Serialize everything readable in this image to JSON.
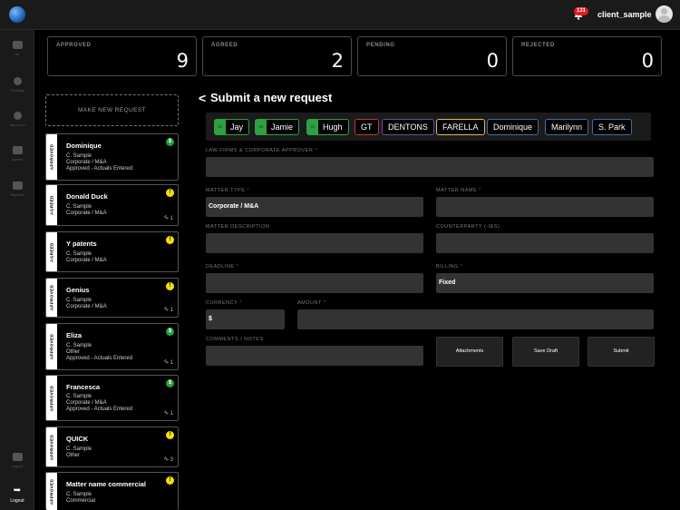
{
  "header": {
    "notification_count": "131",
    "username": "client_sample"
  },
  "sidebar": {
    "items": [
      {
        "label": "All",
        "icon": "inbox-icon"
      },
      {
        "label": "Pending",
        "icon": "gear-icon"
      },
      {
        "label": "Approved",
        "icon": "dollar-icon"
      },
      {
        "label": "Agreed",
        "icon": "calendar-icon"
      },
      {
        "label": "Rejected",
        "icon": "trophy-icon"
      },
      {
        "label": "Logout",
        "icon": "trophy-icon"
      }
    ],
    "logout_label": "Logout"
  },
  "stats": [
    {
      "label": "APPROVED",
      "value": "9"
    },
    {
      "label": "AGREED",
      "value": "2"
    },
    {
      "label": "PENDING",
      "value": "0"
    },
    {
      "label": "REJECTED",
      "value": "0"
    }
  ],
  "make_new_request_label": "MAKE NEW REQUEST",
  "requests": [
    {
      "status": "APPROVED",
      "title": "Dominique",
      "lines": [
        "C. Sample",
        "Corporate / M&A",
        "Approved - Actuals Entered"
      ],
      "indicator": "$",
      "indicator_type": "money",
      "attachments": ""
    },
    {
      "status": "AGREED",
      "title": "Donald Duck",
      "lines": [
        "C. Sample",
        "Corporate / M&A"
      ],
      "indicator": "!",
      "indicator_type": "warn",
      "attachments": "1"
    },
    {
      "status": "AGREED",
      "title": "Y patents",
      "lines": [
        "C. Sample",
        "Corporate / M&A"
      ],
      "indicator": "!",
      "indicator_type": "warn",
      "attachments": ""
    },
    {
      "status": "APPROVED",
      "title": "Genius",
      "lines": [
        "C. Sample",
        "Corporate / M&A"
      ],
      "indicator": "!",
      "indicator_type": "warn",
      "attachments": "1"
    },
    {
      "status": "APPROVED",
      "title": "Eliza",
      "lines": [
        "C. Sample",
        "Other",
        "Approved - Actuals Entered"
      ],
      "indicator": "$",
      "indicator_type": "money",
      "attachments": "1"
    },
    {
      "status": "APPROVED",
      "title": "Francesca",
      "lines": [
        "C. Sample",
        "Corporate / M&A",
        "Approved - Actuals Entered"
      ],
      "indicator": "$",
      "indicator_type": "money",
      "attachments": "1"
    },
    {
      "status": "APPROVED",
      "title": "QUICK",
      "lines": [
        "C. Sample",
        "Other"
      ],
      "indicator": "!",
      "indicator_type": "warn",
      "attachments": "3"
    },
    {
      "status": "APPROVED",
      "title": "Matter name commercial",
      "lines": [
        "C. Sample",
        "Commercial"
      ],
      "indicator": "!",
      "indicator_type": "warn",
      "attachments": ""
    }
  ],
  "form": {
    "title": "Submit a new request",
    "chips": [
      {
        "cc": "cc",
        "label": "Jay",
        "style": "cc"
      },
      {
        "cc": "cc",
        "label": "Jamie",
        "style": "cc"
      },
      {
        "cc": "cc",
        "label": "Hugh",
        "style": "cc"
      },
      {
        "cc": "",
        "label": "GT",
        "style": "red"
      },
      {
        "cc": "",
        "label": "DENTONS",
        "style": "purple"
      },
      {
        "cc": "",
        "label": "FARELLA",
        "style": "yellow"
      },
      {
        "cc": "",
        "label": "Dominique",
        "style": "blue"
      },
      {
        "cc": "",
        "label": "Marilynn",
        "style": "blue"
      },
      {
        "cc": "",
        "label": "S. Park",
        "style": "blue"
      }
    ],
    "law_firms_label": "LAW FIRMS & CORPORATE APPROVER",
    "law_firms_value": "",
    "matter_type_label": "MATTER TYPE",
    "matter_type_value": "Corporate / M&A",
    "matter_name_label": "MATTER NAME",
    "matter_name_value": "",
    "matter_description_label": "MATTER DESCRIPTION",
    "matter_description_value": "",
    "counterparty_label": "COUNTERPARTY (-IES)",
    "counterparty_value": "",
    "deadline_label": "DEADLINE",
    "deadline_value": "",
    "billing_label": "BILLING",
    "billing_value": "Fixed",
    "currency_label": "CURRENCY",
    "currency_value": "$",
    "amount_label": "AMOUNT",
    "amount_value": "",
    "comments_label": "COMMENTS / NOTES",
    "comments_value": "",
    "required_marker": "*",
    "attachments_button": "Attachments",
    "save_draft_button": "Save Draft",
    "submit_button": "Submit"
  },
  "colors": {
    "approved_money": "#22a33a",
    "warning": "#f4e000",
    "notification": "#e31b23",
    "required": "#e02424"
  }
}
